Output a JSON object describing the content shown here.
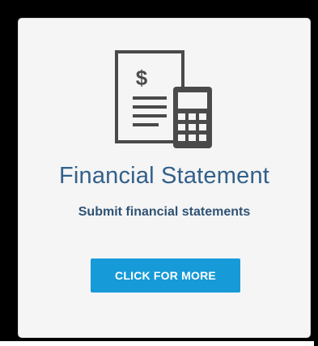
{
  "card": {
    "icon": "financial-statement-icon",
    "title": "Financial Statement",
    "subtitle": "Submit financial statements",
    "button_label": "CLICK FOR MORE"
  },
  "colors": {
    "title": "#33608a",
    "subtitle": "#2f5273",
    "button": "#169ad8",
    "icon": "#4a4a4a"
  }
}
